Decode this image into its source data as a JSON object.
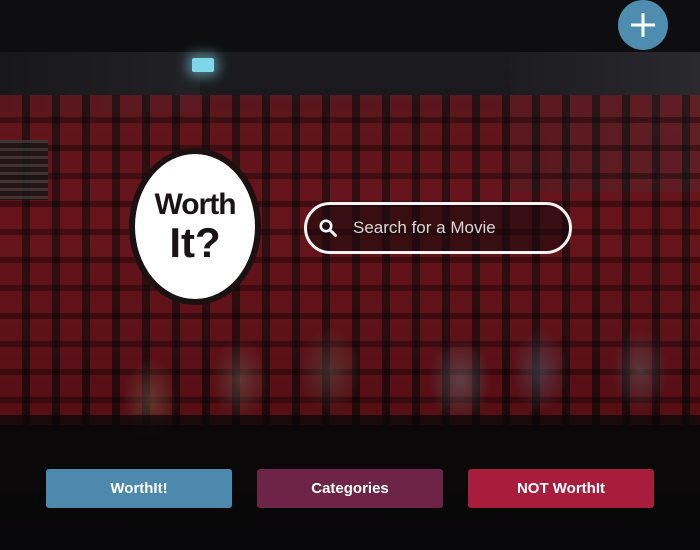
{
  "logo": {
    "line1": "Worth",
    "line2": "It?"
  },
  "search": {
    "placeholder": "Search for a Movie",
    "value": ""
  },
  "add_button": {
    "icon": "plus-icon"
  },
  "buttons": {
    "worthit": "WorthIt!",
    "categories": "Categories",
    "not_worthit": "NOT WorthIt"
  },
  "colors": {
    "worthit": "#4d88ad",
    "categories": "#6e2447",
    "not_worthit": "#a81c3c",
    "add_button": "#4f8db0"
  }
}
